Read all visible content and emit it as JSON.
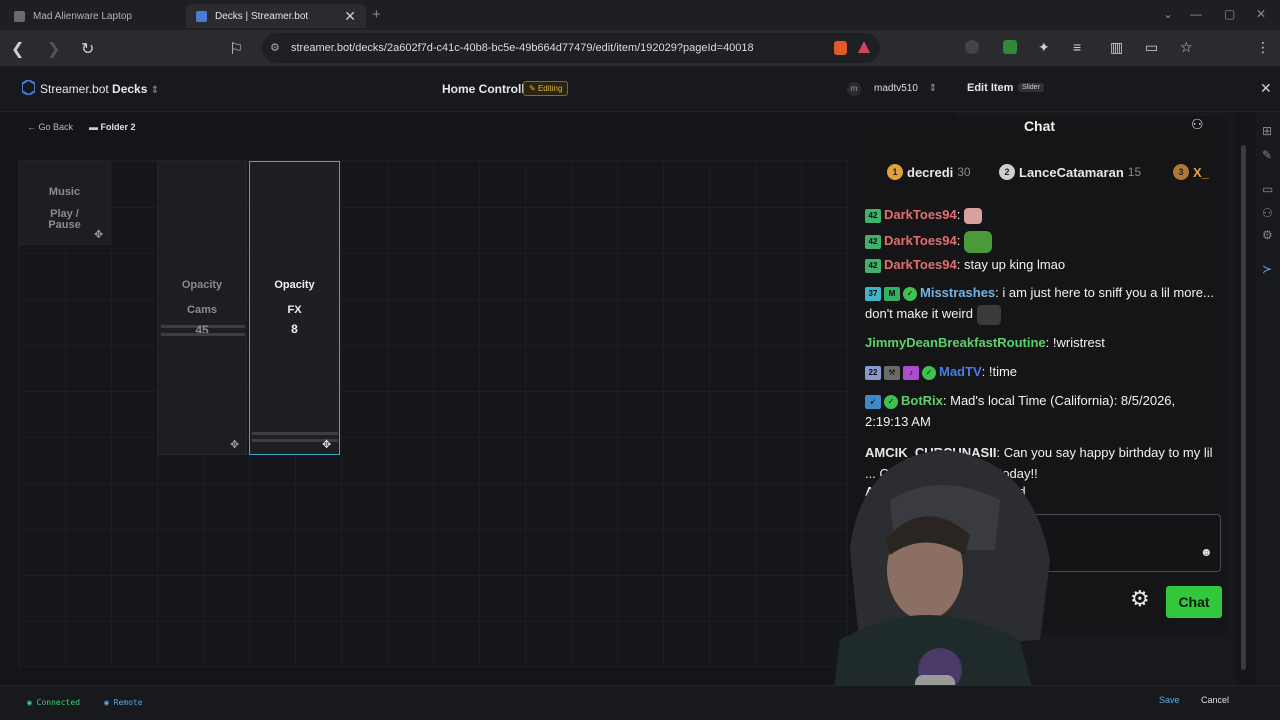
{
  "browser": {
    "tabs": [
      {
        "title": "Mad Alienware Laptop",
        "active": false
      },
      {
        "title": "Decks | Streamer.bot",
        "active": true
      }
    ],
    "url": "streamer.bot/decks/2a602f7d-c41c-40b8-bc5e-49b664d77479/edit/item/192029?pageId=40018"
  },
  "app": {
    "brand_name": "Streamer.bot",
    "brand_section": "Decks",
    "deck_title": "Home Controll",
    "editing_badge": "Editing",
    "user_initial": "m",
    "username": "madtv510",
    "edit_panel_title": "Edit Item",
    "edit_panel_badge": "Slider"
  },
  "subnav": {
    "back_label": "Go Back",
    "folder_label": "Folder 2"
  },
  "tiles": [
    {
      "title": "Music",
      "subtitle": "Play / Pause"
    },
    {
      "title": "Opacity",
      "subtitle": "Cams",
      "value": "45"
    },
    {
      "title": "Opacity",
      "subtitle": "FX",
      "value": "8",
      "selected": true
    }
  ],
  "chat": {
    "title": "Chat",
    "pinned": [
      {
        "rank": "1",
        "name": "decredi",
        "count": "30"
      },
      {
        "rank": "2",
        "name": "LanceCatamaran",
        "count": "15"
      },
      {
        "rank": "3",
        "name": "X_",
        "count": ""
      }
    ],
    "messages": [
      {
        "user": "DarkToes94",
        "text": "",
        "badge": "42"
      },
      {
        "user": "DarkToes94",
        "text": "",
        "badge": "42"
      },
      {
        "user": "DarkToes94",
        "text": "stay up king lmao",
        "badge": "42"
      },
      {
        "user": "Misstrashes",
        "text": "i am just here to sniff you a lil more... don't make it weird",
        "badge": "37"
      },
      {
        "user": "JimmyDeanBreakfastRoutine",
        "text": "!wristrest"
      },
      {
        "user": "MadTV",
        "text": "!time",
        "badge": "22"
      },
      {
        "user": "BotRix",
        "text": "Mad's local Time (California): 8/5/2026, 2:19:13 AM"
      },
      {
        "user": "AMCIK_CURCUNASII",
        "text": "Can you say happy birthday to my lil ... Owners? He turns 6 today!!"
      },
      {
        "user": "AMCI",
        "text": "xd"
      }
    ],
    "send_label": "Chat"
  },
  "footer": {
    "connected_label": "Connected",
    "remote_label": "Remote",
    "save_label": "Save",
    "cancel_label": "Cancel"
  },
  "colors": {
    "accent": "#3fa6c6",
    "connected": "#3fd07a",
    "remote": "#5aa9e6",
    "chat_button": "#32c83b",
    "editing_badge": "#e3b341"
  }
}
